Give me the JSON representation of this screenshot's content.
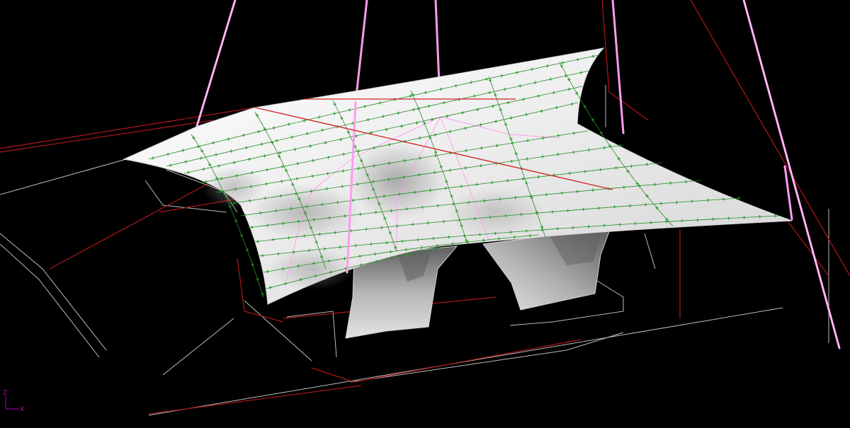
{
  "viewport": {
    "background": "#000000",
    "colors": {
      "cable": "#ff9bf0",
      "edge": "#c8c8c8",
      "support": "#b01818",
      "mesh_line": "#2a8a2a",
      "mesh_node": "#1e9a1e",
      "membrane_light": "#f2f2f2",
      "membrane_shade": "#8a8a8a"
    }
  },
  "axes": {
    "y_label": "Z",
    "x_label": "X",
    "color": "#c000c0"
  }
}
